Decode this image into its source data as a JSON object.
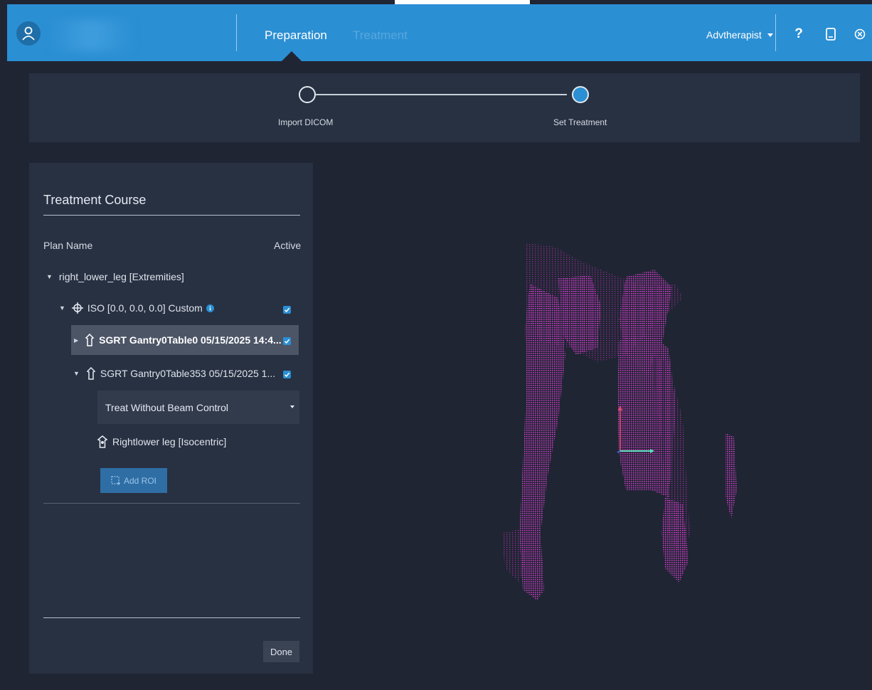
{
  "header": {
    "tabs": [
      {
        "label": "Preparation",
        "active": true
      },
      {
        "label": "Treatment",
        "active": false
      }
    ],
    "user": "Advtherapist",
    "icons": [
      "user-icon",
      "help-icon",
      "tablet-icon",
      "close-icon"
    ],
    "help_glyph": "?",
    "accent_color": "#2b8fd3"
  },
  "stepper": {
    "steps": [
      {
        "label": "Import DICOM",
        "complete": false
      },
      {
        "label": "Set Treatment",
        "complete": true
      }
    ]
  },
  "course": {
    "title": "Treatment Course",
    "col_plan": "Plan Name",
    "col_active": "Active",
    "plan": "right_lower_leg [Extremities]",
    "iso": {
      "label": "ISO [0.0, 0.0, 0.0] Custom",
      "active": true
    },
    "setups": [
      {
        "label": "SGRT Gantry0Table0 05/15/2025 14:4...",
        "active": true,
        "selected": true,
        "expanded": false
      },
      {
        "label": "SGRT Gantry0Table353 05/15/2025 1...",
        "active": true,
        "selected": false,
        "expanded": true
      }
    ],
    "beam_mode": "Treat Without Beam Control",
    "roi": "Rightlower leg [Isocentric]",
    "add_roi": "Add ROI",
    "done": "Done"
  },
  "viewport": {
    "point_cloud_color": "#c93cc4",
    "axis_colors": {
      "x": "#5fe0c0",
      "y": "#e04a6a",
      "z": "#4a6ae0"
    }
  }
}
